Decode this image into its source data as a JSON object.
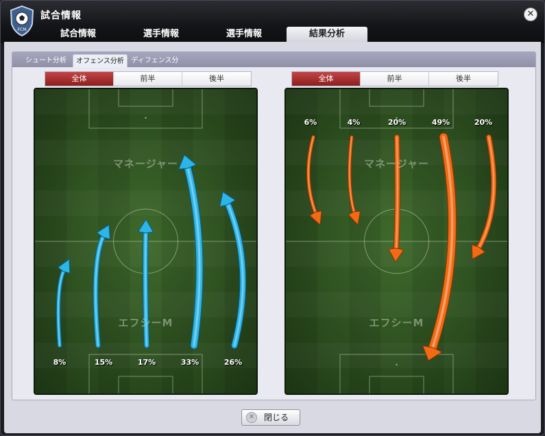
{
  "window": {
    "title": "試合情報",
    "logo_text": "FCM",
    "close_icon": "close-icon"
  },
  "main_tabs": [
    {
      "label": "試合情報",
      "active": false
    },
    {
      "label": "選手情報",
      "active": false
    },
    {
      "label": "選手情報",
      "active": false
    },
    {
      "label": "結果分析",
      "active": true
    }
  ],
  "sub_tabs": [
    {
      "label": "シュート分析",
      "active": false
    },
    {
      "label": "オフェンス分析",
      "active": true
    },
    {
      "label": "ディフェンス分析",
      "active": false
    }
  ],
  "left_panel": {
    "segments": [
      {
        "label": "全体",
        "active": true
      },
      {
        "label": "前半",
        "active": false
      },
      {
        "label": "後半",
        "active": false
      }
    ],
    "top_team": "マネージャー",
    "bottom_team": "エフシーM",
    "arrow_direction": "up",
    "arrow_color": "#2bb6e8",
    "percentages": [
      "8%",
      "15%",
      "17%",
      "33%",
      "26%"
    ],
    "shares": [
      8,
      15,
      17,
      33,
      26
    ]
  },
  "right_panel": {
    "segments": [
      {
        "label": "全体",
        "active": true
      },
      {
        "label": "前半",
        "active": false
      },
      {
        "label": "後半",
        "active": false
      }
    ],
    "top_team": "マネージャー",
    "bottom_team": "エフシーM",
    "arrow_direction": "down",
    "arrow_color": "#f26a12",
    "percentages": [
      "6%",
      "4%",
      "20%",
      "49%",
      "20%"
    ],
    "shares": [
      6,
      4,
      20,
      49,
      20
    ]
  },
  "close_button": {
    "label": "閉じる",
    "icon": "close-icon"
  },
  "colors": {
    "active_segment": "#a52f2f",
    "pitch_green": "#2f5522"
  }
}
